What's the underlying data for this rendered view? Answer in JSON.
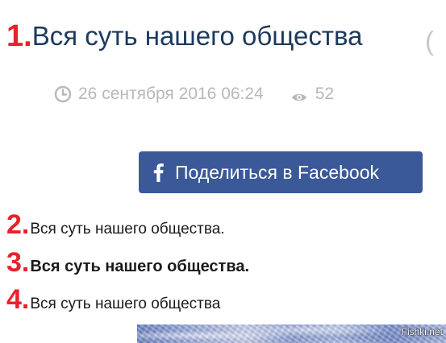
{
  "headline": {
    "number": "1.",
    "text": "Вся суть нашего общества",
    "clipped_tail": "("
  },
  "meta": {
    "icon_clock": "clock-icon",
    "date": "26 сентября 2016 06:24",
    "icon_views": "eye-icon",
    "views": "52"
  },
  "share": {
    "icon": "facebook-icon",
    "label": "Поделиться в Facebook",
    "color": "#3b5998"
  },
  "variants": [
    {
      "number": "2.",
      "text": "Вся суть нашего общества."
    },
    {
      "number": "3.",
      "text": "Вся суть нашего общества."
    },
    {
      "number": "4.",
      "text": "Вся суть нашего общества"
    }
  ],
  "image": {
    "watermark": "Fishki.net"
  },
  "colors": {
    "number_red": "#e8212b",
    "title_blue": "#1b3a5e",
    "meta_gray": "#b8b8b8"
  }
}
